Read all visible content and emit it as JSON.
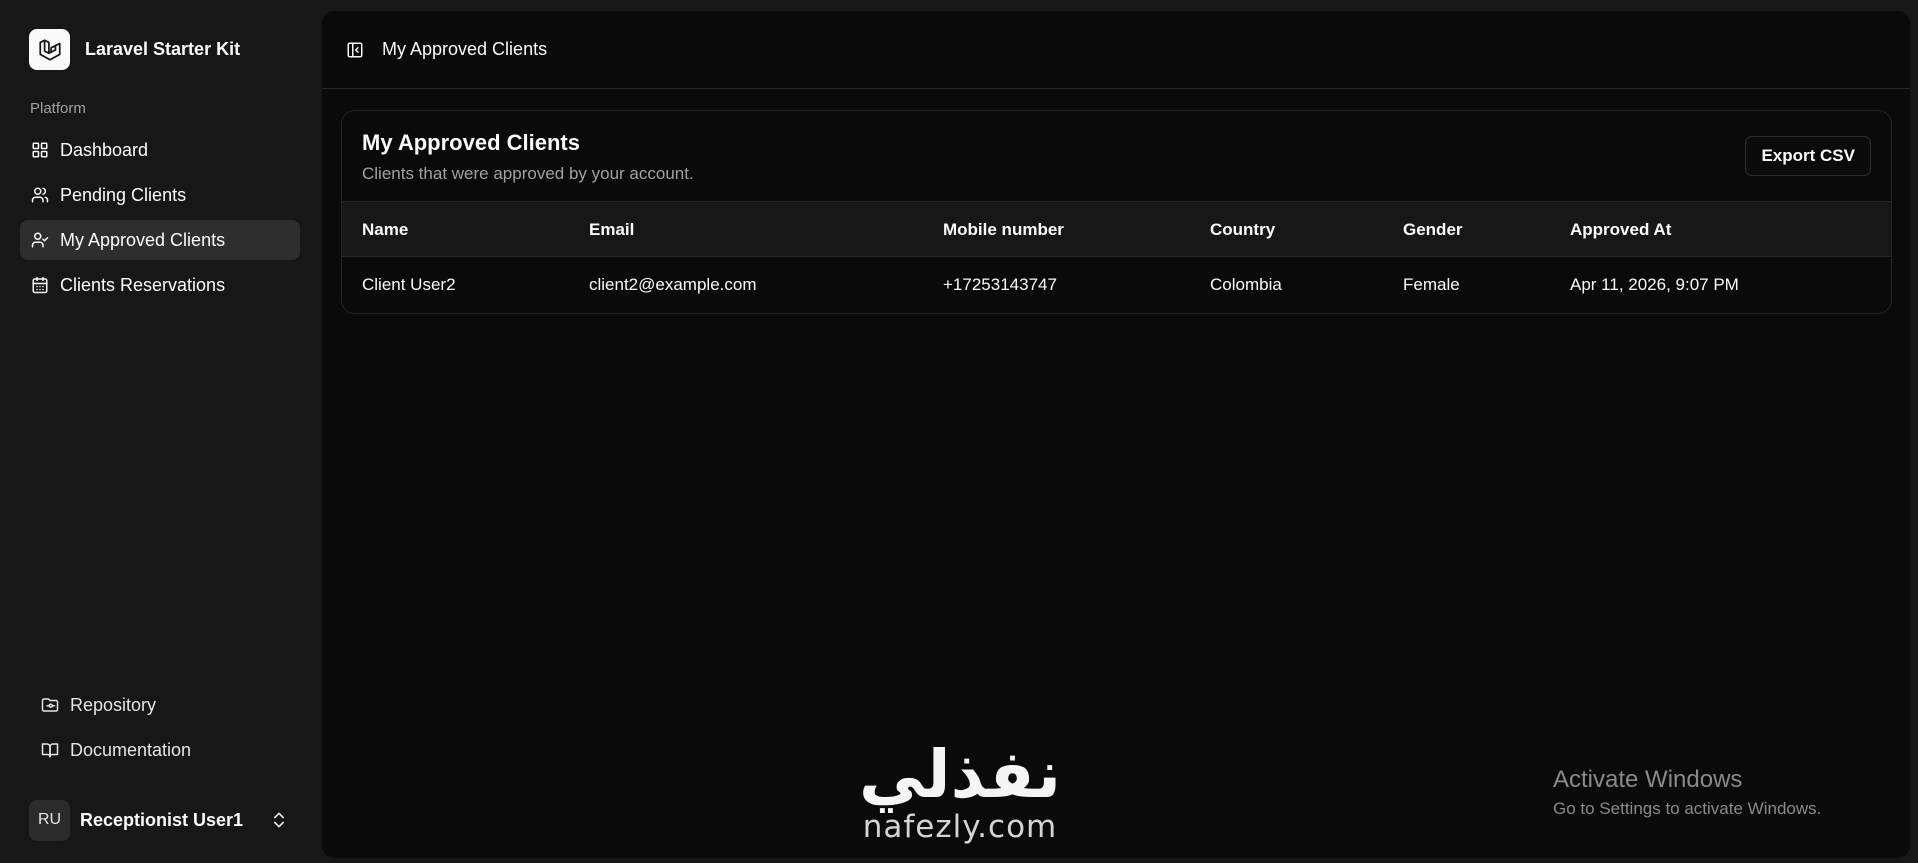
{
  "brand": {
    "name": "Laravel Starter Kit"
  },
  "sidebar": {
    "section_label": "Platform",
    "items": [
      {
        "label": "Dashboard",
        "icon": "dashboard-grid-icon",
        "active": false
      },
      {
        "label": "Pending Clients",
        "icon": "users-icon",
        "active": false
      },
      {
        "label": "My Approved Clients",
        "icon": "user-check-icon",
        "active": true
      },
      {
        "label": "Clients Reservations",
        "icon": "calendar-icon",
        "active": false
      }
    ],
    "footer_items": [
      {
        "label": "Repository",
        "icon": "folder-git-icon"
      },
      {
        "label": "Documentation",
        "icon": "book-icon"
      }
    ]
  },
  "user": {
    "initials": "RU",
    "name": "Receptionist User1"
  },
  "header": {
    "breadcrumb": "My Approved Clients"
  },
  "card": {
    "title": "My Approved Clients",
    "subtitle": "Clients that were approved by your account.",
    "export_label": "Export CSV"
  },
  "table": {
    "columns": [
      "Name",
      "Email",
      "Mobile number",
      "Country",
      "Gender",
      "Approved At"
    ],
    "rows": [
      [
        "Client User2",
        "client2@example.com",
        "+17253143747",
        "Colombia",
        "Female",
        "Apr 11, 2026, 9:07 PM"
      ]
    ]
  },
  "watermark": {
    "arabic": "نفذلي",
    "latin": "nafezly.com"
  },
  "windows_notice": {
    "title": "Activate Windows",
    "subtitle": "Go to Settings to activate Windows."
  },
  "colors": {
    "background": "#171717",
    "main": "#0a0a0a",
    "active_item": "#2e2e2e",
    "muted_text": "#a1a1a1",
    "border": "#262626"
  }
}
